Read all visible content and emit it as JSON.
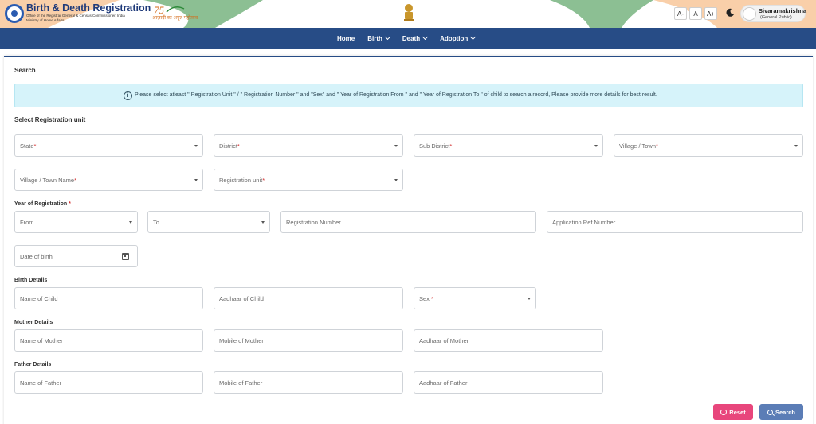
{
  "header": {
    "brand_title": "Birth & Death Registration",
    "brand_subtitle": "Office of the Registrar General & Census Commissioner, India",
    "brand_subtitle2": "Ministry of Home Affairs",
    "azadi_text": "आज़ादी का अमृत महोत्सव",
    "font_small": "A-",
    "font_normal": "A",
    "font_large": "A+",
    "user_name": "Sivaramakrishna",
    "user_role": "(General Public)"
  },
  "nav": {
    "items": [
      {
        "label": "Home",
        "has_dropdown": false
      },
      {
        "label": "Birth",
        "has_dropdown": true
      },
      {
        "label": "Death",
        "has_dropdown": true
      },
      {
        "label": "Adoption",
        "has_dropdown": true
      }
    ]
  },
  "page": {
    "search_title": "Search",
    "info_icon": "i",
    "info_text": "Please select atleast \" Registration Unit \" / \" Registration Number \" and \"Sex\" and \" Year of Registration From \" and \" Year of Registration To \" of child to search a record, Please provide more details for best result.",
    "select_unit_title": "Select Registration unit",
    "year_title": "Year of Registration",
    "required_mark": "*",
    "birth_details_title": "Birth Details",
    "mother_details_title": "Mother Details",
    "father_details_title": "Father Details"
  },
  "fields": {
    "state": "State",
    "district": "District",
    "sub_district": "Sub District",
    "village_town": "Village / Town",
    "village_town_name": "Village / Town Name",
    "registration_unit": "Registration unit",
    "from": "From",
    "to": "To",
    "registration_number": "Registration Number",
    "application_ref": "Application Ref Number",
    "date_of_birth": "Date of birth",
    "name_of_child": "Name of Child",
    "aadhaar_of_child": "Aadhaar of Child",
    "sex": "Sex",
    "name_of_mother": "Name of Mother",
    "mobile_of_mother": "Mobile of Mother",
    "aadhaar_of_mother": "Aadhaar of Mother",
    "name_of_father": "Name of Father",
    "mobile_of_father": "Mobile of Father",
    "aadhaar_of_father": "Aadhaar of Father"
  },
  "buttons": {
    "reset": "Reset",
    "search": "Search"
  },
  "colors": {
    "nav_bg": "#274c86",
    "info_bg": "#d6f3fa",
    "reset_btn": "#e8467c",
    "search_btn": "#5b7db6",
    "required": "#d32f2f"
  }
}
